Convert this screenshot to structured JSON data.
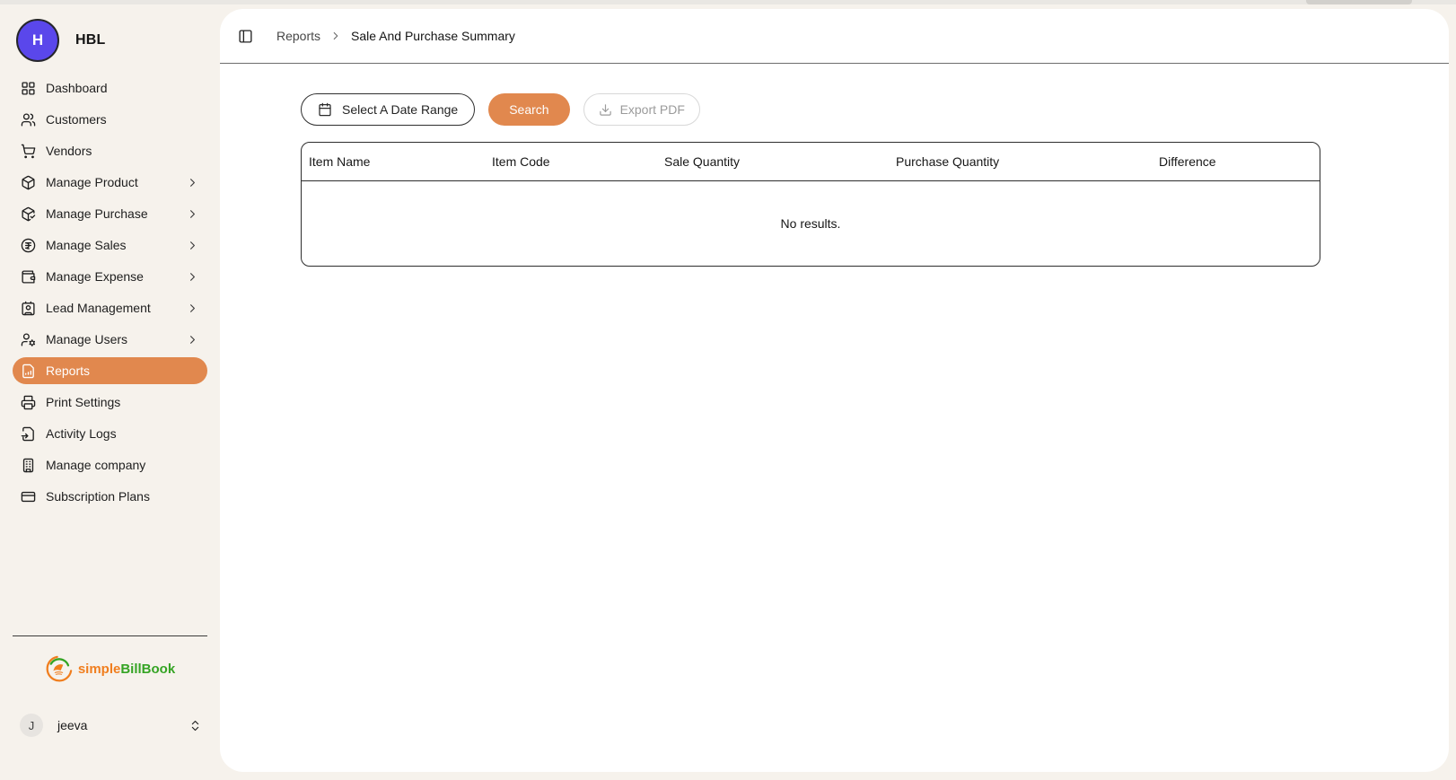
{
  "app": {
    "brand_initial": "H",
    "brand_name": "HBL"
  },
  "sidebar": {
    "items": [
      {
        "label": "Dashboard",
        "icon": "layout-grid-icon",
        "expandable": false,
        "active": false
      },
      {
        "label": "Customers",
        "icon": "users-icon",
        "expandable": false,
        "active": false
      },
      {
        "label": "Vendors",
        "icon": "shopping-cart-icon",
        "expandable": false,
        "active": false
      },
      {
        "label": "Manage Product",
        "icon": "package-icon",
        "expandable": true,
        "active": false
      },
      {
        "label": "Manage Purchase",
        "icon": "package-check-icon",
        "expandable": true,
        "active": false
      },
      {
        "label": "Manage Sales",
        "icon": "rupee-circle-icon",
        "expandable": true,
        "active": false
      },
      {
        "label": "Manage Expense",
        "icon": "wallet-icon",
        "expandable": true,
        "active": false
      },
      {
        "label": "Lead Management",
        "icon": "contact-card-icon",
        "expandable": true,
        "active": false
      },
      {
        "label": "Manage Users",
        "icon": "user-cog-icon",
        "expandable": true,
        "active": false
      },
      {
        "label": "Reports",
        "icon": "file-chart-icon",
        "expandable": false,
        "active": true
      },
      {
        "label": "Print Settings",
        "icon": "printer-icon",
        "expandable": false,
        "active": false
      },
      {
        "label": "Activity Logs",
        "icon": "file-input-icon",
        "expandable": false,
        "active": false
      },
      {
        "label": "Manage company",
        "icon": "building-icon",
        "expandable": false,
        "active": false
      },
      {
        "label": "Subscription Plans",
        "icon": "credit-card-icon",
        "expandable": false,
        "active": false
      }
    ],
    "logo": {
      "part1": "simple",
      "part2": "BillBook"
    },
    "user": {
      "initial": "J",
      "name": "jeeva"
    }
  },
  "header": {
    "breadcrumb": {
      "root": "Reports",
      "current": "Sale And Purchase Summary"
    }
  },
  "toolbar": {
    "date_range_label": "Select A Date Range",
    "search_label": "Search",
    "export_label": "Export PDF"
  },
  "table": {
    "columns": [
      "Item Name",
      "Item Code",
      "Sale Quantity",
      "Purchase Quantity",
      "Difference"
    ],
    "empty_message": "No results."
  },
  "colors": {
    "accent_orange": "#E1884E",
    "brand_purple": "#5A47EB",
    "logo_orange": "#F07E1E",
    "logo_green": "#35A424",
    "page_background": "#F6F2EC"
  }
}
